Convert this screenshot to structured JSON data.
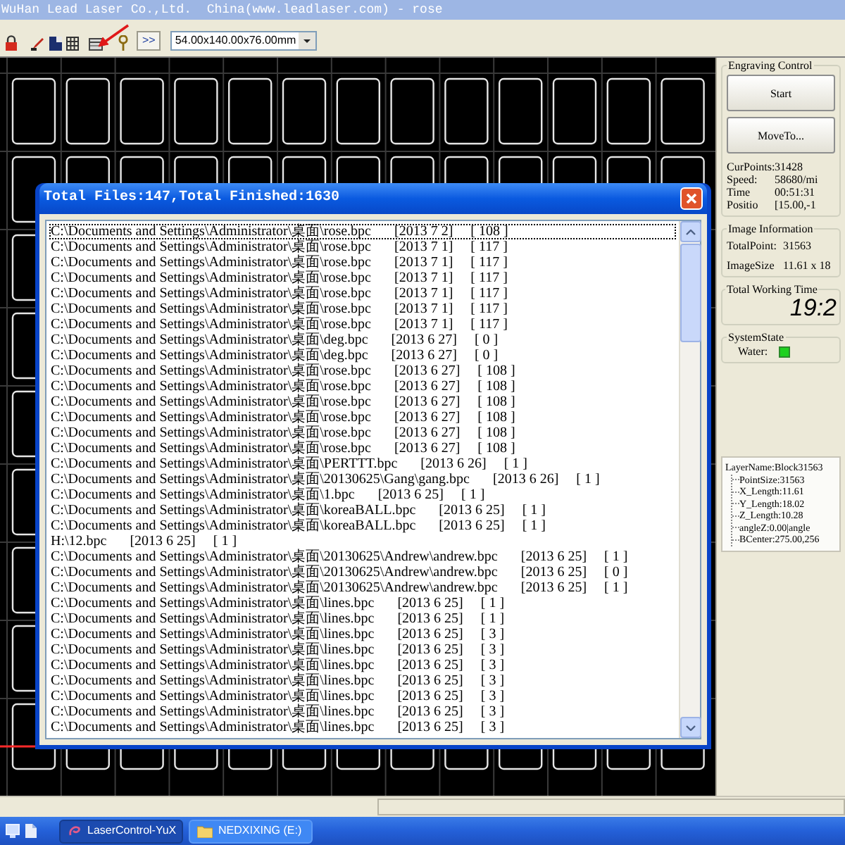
{
  "window": {
    "title": "WuHan Lead Laser Co.,Ltd.  China(www.leadlaser.com) - rose"
  },
  "toolbar": {
    "expand_button": ">>",
    "size_select": {
      "value": "54.00x140.00x76.00mm"
    }
  },
  "dialog": {
    "title": "Total Files:147,Total Finished:1630",
    "rows": [
      {
        "path": "C:\\Documents and Settings\\Administrator\\桌面\\rose.bpc",
        "date": "[2013 7 2]",
        "count": "[ 108 ]",
        "selected": true
      },
      {
        "path": "C:\\Documents and Settings\\Administrator\\桌面\\rose.bpc",
        "date": "[2013 7 1]",
        "count": "[ 117 ]",
        "selected": false
      },
      {
        "path": "C:\\Documents and Settings\\Administrator\\桌面\\rose.bpc",
        "date": "[2013 7 1]",
        "count": "[ 117 ]",
        "selected": false
      },
      {
        "path": "C:\\Documents and Settings\\Administrator\\桌面\\rose.bpc",
        "date": "[2013 7 1]",
        "count": "[ 117 ]",
        "selected": false
      },
      {
        "path": "C:\\Documents and Settings\\Administrator\\桌面\\rose.bpc",
        "date": "[2013 7 1]",
        "count": "[ 117 ]",
        "selected": false
      },
      {
        "path": "C:\\Documents and Settings\\Administrator\\桌面\\rose.bpc",
        "date": "[2013 7 1]",
        "count": "[ 117 ]",
        "selected": false
      },
      {
        "path": "C:\\Documents and Settings\\Administrator\\桌面\\rose.bpc",
        "date": "[2013 7 1]",
        "count": "[ 117 ]",
        "selected": false
      },
      {
        "path": "C:\\Documents and Settings\\Administrator\\桌面\\deg.bpc",
        "date": "[2013 6 27]",
        "count": "[ 0 ]",
        "selected": false
      },
      {
        "path": "C:\\Documents and Settings\\Administrator\\桌面\\deg.bpc",
        "date": "[2013 6 27]",
        "count": "[ 0 ]",
        "selected": false
      },
      {
        "path": "C:\\Documents and Settings\\Administrator\\桌面\\rose.bpc",
        "date": "[2013 6 27]",
        "count": "[ 108 ]",
        "selected": false
      },
      {
        "path": "C:\\Documents and Settings\\Administrator\\桌面\\rose.bpc",
        "date": "[2013 6 27]",
        "count": "[ 108 ]",
        "selected": false
      },
      {
        "path": "C:\\Documents and Settings\\Administrator\\桌面\\rose.bpc",
        "date": "[2013 6 27]",
        "count": "[ 108 ]",
        "selected": false
      },
      {
        "path": "C:\\Documents and Settings\\Administrator\\桌面\\rose.bpc",
        "date": "[2013 6 27]",
        "count": "[ 108 ]",
        "selected": false
      },
      {
        "path": "C:\\Documents and Settings\\Administrator\\桌面\\rose.bpc",
        "date": "[2013 6 27]",
        "count": "[ 108 ]",
        "selected": false
      },
      {
        "path": "C:\\Documents and Settings\\Administrator\\桌面\\rose.bpc",
        "date": "[2013 6 27]",
        "count": "[ 108 ]",
        "selected": false
      },
      {
        "path": "C:\\Documents and Settings\\Administrator\\桌面\\PERTTT.bpc",
        "date": "[2013 6 26]",
        "count": "[ 1 ]",
        "selected": false
      },
      {
        "path": "C:\\Documents and Settings\\Administrator\\桌面\\20130625\\Gang\\gang.bpc",
        "date": "[2013 6 26]",
        "count": "[ 1 ]",
        "selected": false
      },
      {
        "path": "C:\\Documents and Settings\\Administrator\\桌面\\1.bpc",
        "date": "[2013 6 25]",
        "count": "[ 1 ]",
        "selected": false
      },
      {
        "path": "C:\\Documents and Settings\\Administrator\\桌面\\koreaBALL.bpc",
        "date": "[2013 6 25]",
        "count": "[ 1 ]",
        "selected": false
      },
      {
        "path": "C:\\Documents and Settings\\Administrator\\桌面\\koreaBALL.bpc",
        "date": "[2013 6 25]",
        "count": "[ 1 ]",
        "selected": false
      },
      {
        "path": "H:\\12.bpc",
        "date": "[2013 6 25]",
        "count": "[ 1 ]",
        "selected": false
      },
      {
        "path": "C:\\Documents and Settings\\Administrator\\桌面\\20130625\\Andrew\\andrew.bpc",
        "date": "[2013 6 25]",
        "count": "[ 1 ]",
        "selected": false
      },
      {
        "path": "C:\\Documents and Settings\\Administrator\\桌面\\20130625\\Andrew\\andrew.bpc",
        "date": "[2013 6 25]",
        "count": "[ 0 ]",
        "selected": false
      },
      {
        "path": "C:\\Documents and Settings\\Administrator\\桌面\\20130625\\Andrew\\andrew.bpc",
        "date": "[2013 6 25]",
        "count": "[ 1 ]",
        "selected": false
      },
      {
        "path": "C:\\Documents and Settings\\Administrator\\桌面\\lines.bpc",
        "date": "[2013 6 25]",
        "count": "[ 1 ]",
        "selected": false
      },
      {
        "path": "C:\\Documents and Settings\\Administrator\\桌面\\lines.bpc",
        "date": "[2013 6 25]",
        "count": "[ 1 ]",
        "selected": false
      },
      {
        "path": "C:\\Documents and Settings\\Administrator\\桌面\\lines.bpc",
        "date": "[2013 6 25]",
        "count": "[ 3 ]",
        "selected": false
      },
      {
        "path": "C:\\Documents and Settings\\Administrator\\桌面\\lines.bpc",
        "date": "[2013 6 25]",
        "count": "[ 3 ]",
        "selected": false
      },
      {
        "path": "C:\\Documents and Settings\\Administrator\\桌面\\lines.bpc",
        "date": "[2013 6 25]",
        "count": "[ 3 ]",
        "selected": false
      },
      {
        "path": "C:\\Documents and Settings\\Administrator\\桌面\\lines.bpc",
        "date": "[2013 6 25]",
        "count": "[ 3 ]",
        "selected": false
      },
      {
        "path": "C:\\Documents and Settings\\Administrator\\桌面\\lines.bpc",
        "date": "[2013 6 25]",
        "count": "[ 3 ]",
        "selected": false
      },
      {
        "path": "C:\\Documents and Settings\\Administrator\\桌面\\lines.bpc",
        "date": "[2013 6 25]",
        "count": "[ 3 ]",
        "selected": false
      },
      {
        "path": "C:\\Documents and Settings\\Administrator\\桌面\\lines.bpc",
        "date": "[2013 6 25]",
        "count": "[ 3 ]",
        "selected": false
      }
    ]
  },
  "side_panel": {
    "engraving_control": {
      "title": "Engraving Control",
      "buttons": [
        "Start",
        "MoveTo..."
      ]
    },
    "readouts": [
      {
        "label": "CurPoints:",
        "value": "31428"
      },
      {
        "label": "Speed:",
        "value": "58680/mi"
      },
      {
        "label": "Time",
        "value": "00:51:31"
      },
      {
        "label": "Positio",
        "value": "[15.00,-1"
      }
    ],
    "image_information": {
      "title": "Image Information",
      "rows": [
        {
          "label": "TotalPoint:",
          "value": "31563"
        },
        {
          "label": "ImageSize",
          "value": "11.61 x 18"
        }
      ]
    },
    "total_working_time": {
      "title": "Total Working Time",
      "value": "19:2"
    },
    "system_state": {
      "title": "SystemState",
      "items": [
        {
          "label": "Water:",
          "on": true
        }
      ]
    },
    "layer_tree": {
      "label": "LayerName:Block31563",
      "children": [
        {
          "label": "PointSize:31563"
        },
        {
          "label": "X_Length:11.61"
        },
        {
          "label": "Y_Length:18.02"
        },
        {
          "label": "Z_Length:10.28"
        },
        {
          "label": "angleZ:0.00|angle"
        },
        {
          "label": "BCenter:275.00,256"
        }
      ]
    }
  },
  "taskbar": {
    "tasks": [
      {
        "label": "LaserControl-YuX",
        "kind": "app",
        "selected": true
      },
      {
        "label": "NEDXIXING (E:)",
        "kind": "folder",
        "selected": false
      }
    ]
  }
}
